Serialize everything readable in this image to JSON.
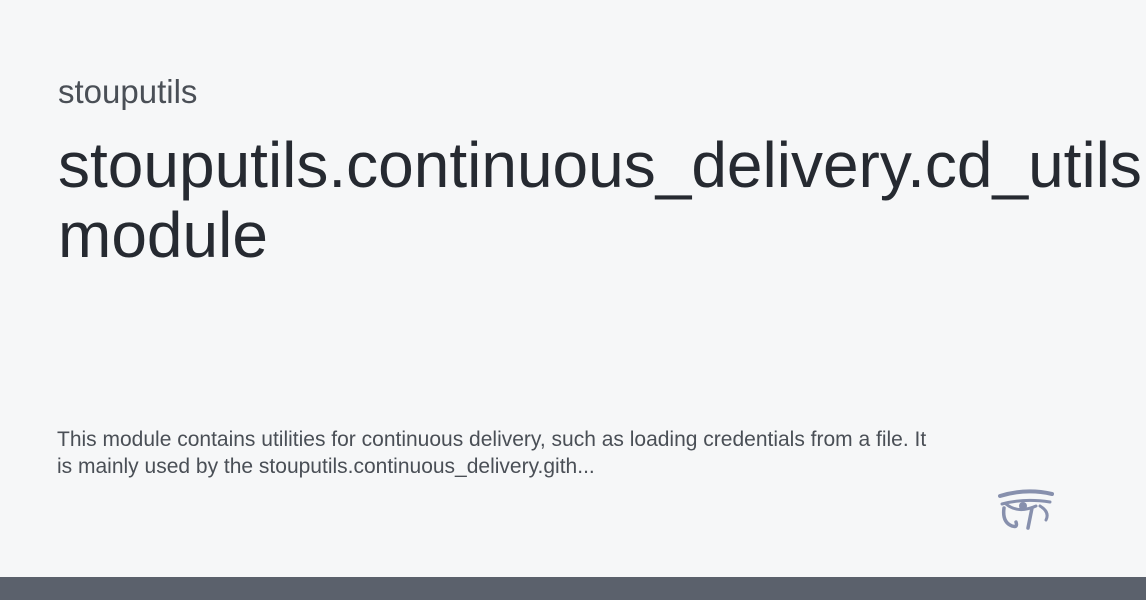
{
  "site": {
    "name": "stouputils"
  },
  "page": {
    "title_line1": "stouputils.continuous_delivery.cd_utils",
    "title_line2": "module",
    "description_line1": "This module contains utilities for continuous delivery, such as loading credentials from a file. It",
    "description_line2": "is mainly used by the stouputils.continuous_delivery.gith..."
  },
  "branding": {
    "logo_icon": "eye-of-horus-icon",
    "logo_color": "#8790ad"
  },
  "colors": {
    "background": "#f6f7f8",
    "title": "#262a31",
    "text": "#4a4f56",
    "footer": "#5b616c"
  }
}
